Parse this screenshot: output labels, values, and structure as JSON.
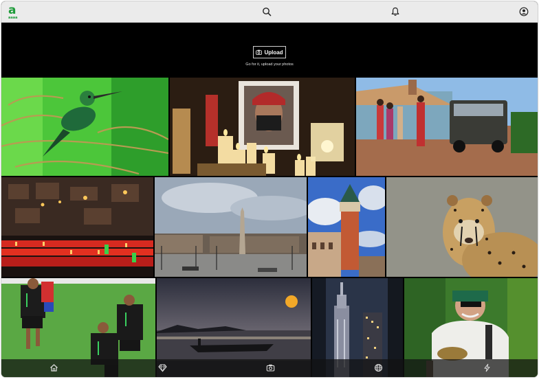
{
  "app": {
    "logo_letter": "a",
    "logo_sub": "aaaa"
  },
  "header": {
    "icons": [
      "search-icon",
      "bell-icon",
      "user-icon"
    ]
  },
  "hero": {
    "upload_label": "Upload",
    "upload_icon": "camera-icon",
    "subtitle": "Go for it, upload your photos"
  },
  "gallery": {
    "photos": [
      "hummingbird",
      "candles-portrait",
      "village-jeep",
      "red-candles-cave",
      "city-square-obelisk",
      "bell-tower",
      "cheetah",
      "soccer-players",
      "sunset-boat",
      "skyscraper-night",
      "man-bandana"
    ]
  },
  "bottom_nav": {
    "icons": [
      "home-icon",
      "diamond-icon",
      "camera-icon",
      "globe-icon",
      "lightning-icon"
    ]
  },
  "colors": {
    "brand": "#1e9b3a",
    "topbar": "#ebebeb",
    "background": "#000000"
  }
}
